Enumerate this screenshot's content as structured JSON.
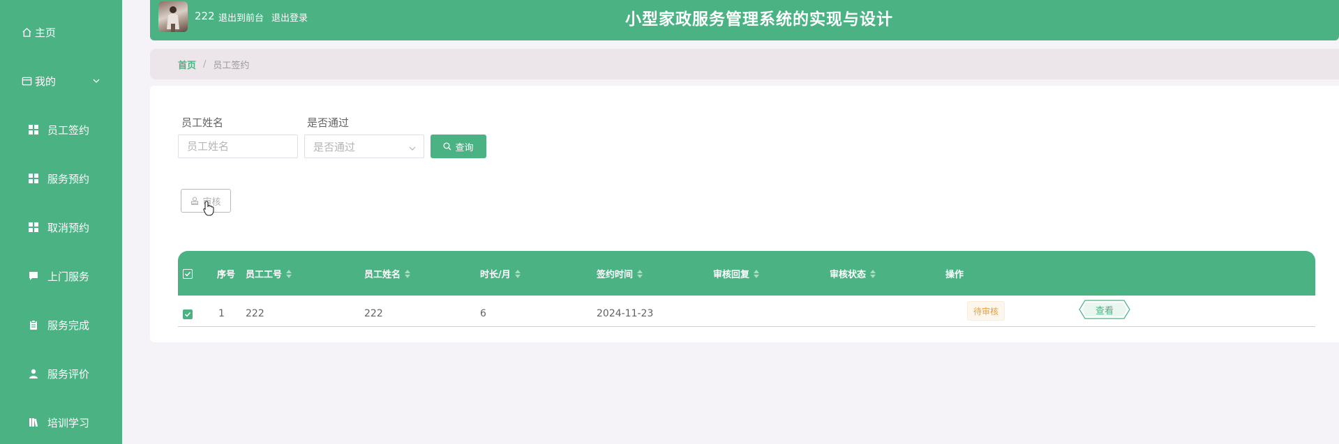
{
  "header": {
    "user_name": "222",
    "link_front": "退出到前台",
    "link_logout": "退出登录",
    "title": "小型家政服务管理系统的实现与设计"
  },
  "sidebar": {
    "home": "主页",
    "mine": "我的",
    "items": [
      {
        "label": "员工签约",
        "icon": "grid-icon"
      },
      {
        "label": "服务预约",
        "icon": "grid-icon"
      },
      {
        "label": "取消预约",
        "icon": "grid-icon"
      },
      {
        "label": "上门服务",
        "icon": "chat-icon"
      },
      {
        "label": "服务完成",
        "icon": "clipboard-icon"
      },
      {
        "label": "服务评价",
        "icon": "user-icon"
      },
      {
        "label": "培训学习",
        "icon": "book-icon"
      }
    ]
  },
  "breadcrumb": {
    "home": "首页",
    "separator": "/",
    "current": "员工签约"
  },
  "filters": {
    "name_label": "员工姓名",
    "name_placeholder": "员工姓名",
    "pass_label": "是否通过",
    "pass_placeholder": "是否通过",
    "query_label": "查询"
  },
  "actions": {
    "audit_label": "审核"
  },
  "table": {
    "headers": {
      "index": "序号",
      "emp_id": "员工工号",
      "emp_name": "员工姓名",
      "duration": "时长/月",
      "sign_time": "签约时间",
      "reply": "审核回复",
      "status": "审核状态",
      "ops": "操作"
    },
    "rows": [
      {
        "index": "1",
        "emp_id": "222",
        "emp_name": "222",
        "duration": "6",
        "sign_time": "2024-11-23",
        "reply": "",
        "status": "待审核",
        "view": "查看"
      }
    ]
  },
  "colors": {
    "primary": "#4bb283",
    "warning": "#e6a23c"
  }
}
